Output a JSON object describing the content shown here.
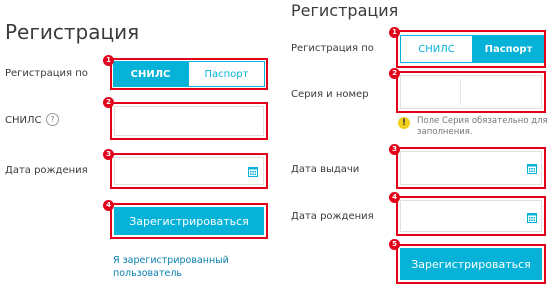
{
  "left": {
    "title": "Регистрация",
    "reg_by_label": "Регистрация по",
    "segments": [
      "СНИЛС",
      "Паспорт"
    ],
    "snils_label": "СНИЛС",
    "help_symbol": "?",
    "birth_label": "Дата рождения",
    "submit_label": "Зарегистрироваться",
    "registered_link": "Я зарегистрированный пользователь",
    "markers": [
      "1",
      "2",
      "3",
      "4"
    ]
  },
  "right": {
    "title": "Регистрация",
    "reg_by_label": "Регистрация по",
    "segments": [
      "СНИЛС",
      "Паспорт"
    ],
    "series_label": "Серия и номер",
    "warning_symbol": "!",
    "warning_text": "Поле Серия обязательно для заполнения.",
    "issue_label": "Дата выдачи",
    "birth_label": "Дата рождения",
    "submit_label": "Зарегистрироваться",
    "markers": [
      "1",
      "2",
      "3",
      "4",
      "5"
    ]
  },
  "colors": {
    "accent": "#06b2d8",
    "highlight": "#e3001b",
    "warning": "#f2d019",
    "link": "#0a7fb0"
  },
  "icons": [
    "calendar-icon",
    "help-icon",
    "warning-icon"
  ]
}
